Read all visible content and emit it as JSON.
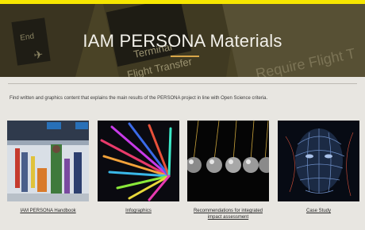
{
  "header": {
    "title": "IAM PERSONA Materials",
    "background_text": [
      "End",
      "Terminal",
      "Flight Transfer",
      "Require Flight T"
    ],
    "accent_color": "#f6e600",
    "rule_color": "#d8a64a"
  },
  "intro": {
    "text": "Find written and graphics content that explains the main results of the PERSONA project in line with Open Science criteria."
  },
  "cards": [
    {
      "label": "IAM PERSONA Handbook",
      "image": "airport-travelers-photo"
    },
    {
      "label": "Infographics",
      "image": "colorful-radial-lights-photo"
    },
    {
      "label": "Recommendations for integrated impact assessment",
      "label_line1": "Recommendations for integrated",
      "label_line2": "impact assessment",
      "image": "newtons-cradle-photo"
    },
    {
      "label": "Case Study",
      "image": "digital-face-photo"
    }
  ]
}
